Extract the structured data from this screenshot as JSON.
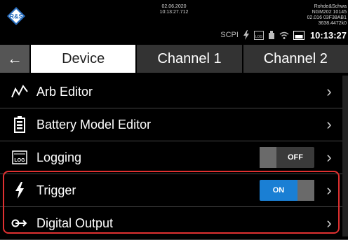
{
  "status": {
    "date": "02.06.2020",
    "time_small": "10:13:27.712",
    "device_line1": "Rohde&Schwa",
    "device_line2": "NGM202 10145",
    "device_line3": "02.016 03F38AB1",
    "device_line4": "3638.4472k0",
    "scpi": "SCPI",
    "clock": "10:13:27"
  },
  "tabs": {
    "device": "Device",
    "channel1": "Channel 1",
    "channel2": "Channel 2"
  },
  "menu": {
    "arb": "Arb Editor",
    "battery": "Battery Model Editor",
    "logging": "Logging",
    "logging_state": "OFF",
    "trigger": "Trigger",
    "trigger_state": "ON",
    "digital": "Digital Output"
  },
  "colors": {
    "accent": "#1a7fd4",
    "highlight": "#e03131"
  }
}
